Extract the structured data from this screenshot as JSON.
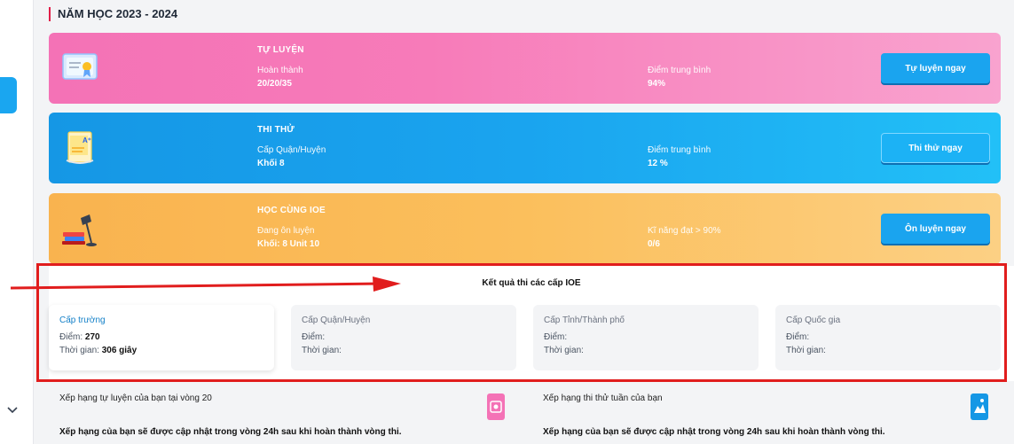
{
  "year_title": "NĂM HỌC 2023 - 2024",
  "cards": [
    {
      "key": "self-practice",
      "title": "TỰ LUYỆN",
      "left_label": "Hoàn thành",
      "left_value": "20/20/35",
      "right_label": "Điểm trung bình",
      "right_value": "94%",
      "button": "Tự luyện ngay"
    },
    {
      "key": "mock-exam",
      "title": "THI THỬ",
      "left_label": "Cấp Quận/Huyện",
      "left_value": "Khối 8",
      "right_label": "Điểm trung bình",
      "right_value": "12 %",
      "button": "Thi thử ngay"
    },
    {
      "key": "learn-ioe",
      "title": "HỌC CÙNG IOE",
      "left_label": "Đang ôn luyện",
      "left_value": "Khối: 8 Unit 10",
      "right_label": "Kĩ năng đạt > 90%",
      "right_value": "0/6",
      "button": "Ôn luyện ngay"
    }
  ],
  "results": {
    "title": "Kết quả thi các cấp IOE",
    "levels": [
      {
        "name": "Cấp trường",
        "score_label": "Điểm:",
        "score": "270",
        "time_label": "Thời gian:",
        "time": "306 giây"
      },
      {
        "name": "Cấp Quận/Huyện",
        "score_label": "Điểm:",
        "score": "",
        "time_label": "Thời gian:",
        "time": ""
      },
      {
        "name": "Cấp Tỉnh/Thành phố",
        "score_label": "Điểm:",
        "score": "",
        "time_label": "Thời gian:",
        "time": ""
      },
      {
        "name": "Cấp Quốc gia",
        "score_label": "Điểm:",
        "score": "",
        "time_label": "Thời gian:",
        "time": ""
      }
    ]
  },
  "ranking": {
    "self_title": "Xếp hạng tự luyện của bạn tại vòng 20",
    "self_desc": "Xếp hạng của bạn sẽ được cập nhật trong vòng 24h sau khi hoàn thành vòng thi.",
    "mock_title": "Xếp hạng thi thử tuần của bạn",
    "mock_desc": "Xếp hạng của bạn sẽ được cập nhật trong vòng 24h sau khi hoàn thành vòng thi."
  },
  "colors": {
    "accent": "#1aa4ef",
    "highlight": "#e11d1d",
    "pink": "#f472b6",
    "blue": "#1597e5",
    "orange": "#f9b34f"
  }
}
